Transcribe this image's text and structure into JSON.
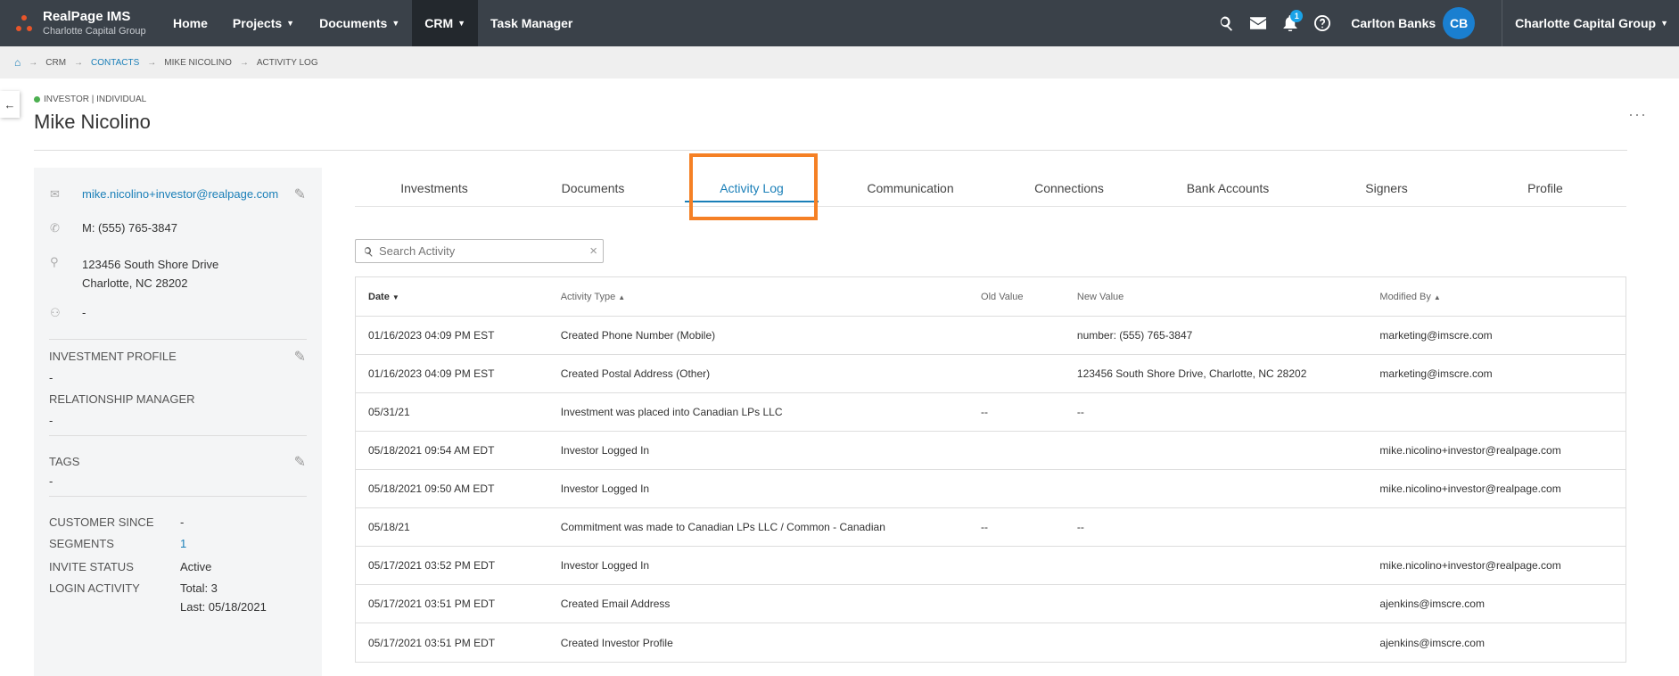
{
  "topnav": {
    "brand": "RealPage IMS",
    "brand_sub": "Charlotte Capital Group",
    "items": [
      {
        "label": "Home",
        "caret": false,
        "active": false
      },
      {
        "label": "Projects",
        "caret": true,
        "active": false
      },
      {
        "label": "Documents",
        "caret": true,
        "active": false
      },
      {
        "label": "CRM",
        "caret": true,
        "active": true
      },
      {
        "label": "Task Manager",
        "caret": false,
        "active": false
      }
    ],
    "notification_count": "1",
    "user_name": "Carlton Banks",
    "user_initials": "CB",
    "org_name": "Charlotte Capital Group",
    "icons": [
      "search-icon",
      "mail-icon",
      "bell-icon",
      "help-icon"
    ]
  },
  "breadcrumb": [
    "CRM",
    "CONTACTS",
    "MIKE NICOLINO",
    "ACTIVITY LOG"
  ],
  "contact": {
    "status": "INVESTOR | INDIVIDUAL",
    "name": "Mike Nicolino",
    "email": "mike.nicolino+investor@realpage.com",
    "phone": "M: (555) 765-3847",
    "address_line1": "123456 South Shore Drive",
    "address_line2": "Charlotte, NC 28202",
    "contact_person": "-",
    "investment_profile_label": "INVESTMENT PROFILE",
    "investment_profile_value": "-",
    "relationship_manager_label": "RELATIONSHIP MANAGER",
    "relationship_manager_value": "-",
    "tags_label": "TAGS",
    "tags_value": "-",
    "customer_since_label": "CUSTOMER SINCE",
    "customer_since_value": "-",
    "segments_label": "SEGMENTS",
    "segments_value": "1",
    "invite_status_label": "INVITE STATUS",
    "invite_status_value": "Active",
    "login_activity_label": "LOGIN ACTIVITY",
    "login_total": "Total: 3",
    "login_last": "Last: 05/18/2021"
  },
  "tabs": [
    "Investments",
    "Documents",
    "Activity Log",
    "Communication",
    "Connections",
    "Bank Accounts",
    "Signers",
    "Profile"
  ],
  "active_tab": "Activity Log",
  "search": {
    "placeholder": "Search Activity"
  },
  "table": {
    "headers": {
      "date": "Date",
      "type": "Activity Type",
      "old": "Old Value",
      "new": "New Value",
      "modified": "Modified By"
    },
    "rows": [
      {
        "date": "01/16/2023 04:09 PM EST",
        "type": "Created Phone Number (Mobile)",
        "old": "",
        "new": "number: (555) 765-3847",
        "modified": "marketing@imscre.com"
      },
      {
        "date": "01/16/2023 04:09 PM EST",
        "type": "Created Postal Address (Other)",
        "old": "",
        "new": "123456 South Shore Drive, Charlotte, NC 28202",
        "modified": "marketing@imscre.com"
      },
      {
        "date": "05/31/21",
        "type": "Investment was placed into Canadian LPs LLC",
        "old": "--",
        "new": "--",
        "modified": ""
      },
      {
        "date": "05/18/2021 09:54 AM EDT",
        "type": "Investor Logged In",
        "old": "",
        "new": "",
        "modified": "mike.nicolino+investor@realpage.com"
      },
      {
        "date": "05/18/2021 09:50 AM EDT",
        "type": "Investor Logged In",
        "old": "",
        "new": "",
        "modified": "mike.nicolino+investor@realpage.com"
      },
      {
        "date": "05/18/21",
        "type": "Commitment was made to Canadian LPs LLC / Common - Canadian",
        "old": "--",
        "new": "--",
        "modified": ""
      },
      {
        "date": "05/17/2021 03:52 PM EDT",
        "type": "Investor Logged In",
        "old": "",
        "new": "",
        "modified": "mike.nicolino+investor@realpage.com"
      },
      {
        "date": "05/17/2021 03:51 PM EDT",
        "type": "Created Email Address",
        "old": "",
        "new": "",
        "modified": "ajenkins@imscre.com"
      },
      {
        "date": "05/17/2021 03:51 PM EDT",
        "type": "Created Investor Profile",
        "old": "",
        "new": "",
        "modified": "ajenkins@imscre.com"
      }
    ]
  },
  "colors": {
    "nav_bg": "#3a4149",
    "accent": "#1a7fb8",
    "highlight": "#f58025",
    "avatar": "#1a7fd0"
  }
}
